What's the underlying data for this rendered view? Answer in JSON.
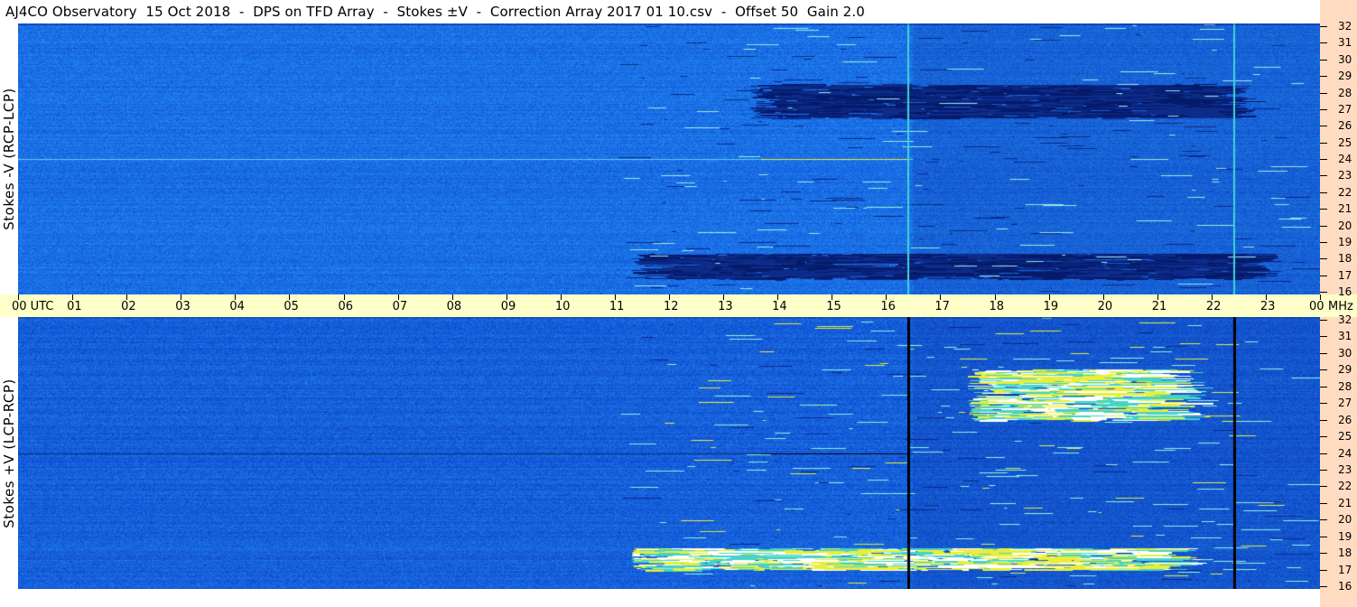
{
  "title": "AJ4CO Observatory  15 Oct 2018  -  DPS on TFD Array  -  Stokes ±V  -  Correction Array 2017 01 10.csv  -  Offset 50  Gain 2.0",
  "panels": [
    {
      "label": "Stokes -V (RCP-LCP)"
    },
    {
      "label": "Stokes +V (LCP-RCP)"
    }
  ],
  "colors": {
    "background_blue": "#1a6be0",
    "deep_blue": "#0b3ea8",
    "time_axis_bg": "#ffffc9",
    "right_strip_bg": "#ffdcc1",
    "spike_cyan": "#3fd6d6",
    "emission_yellow": "#e8ee3a"
  },
  "chart_data": {
    "type": "heatmap",
    "description_of_axes": "time (UTC) vs frequency (MHz)",
    "x": {
      "unit": "UTC",
      "ticks": [
        "00 UTC",
        "01",
        "02",
        "03",
        "04",
        "05",
        "06",
        "07",
        "08",
        "09",
        "10",
        "11",
        "12",
        "13",
        "14",
        "15",
        "16",
        "17",
        "18",
        "19",
        "20",
        "21",
        "22",
        "23",
        "00"
      ],
      "range": [
        0,
        24
      ]
    },
    "y": {
      "unit": "MHz",
      "ticks": [
        "16",
        "17",
        "18",
        "19",
        "20",
        "21",
        "22",
        "23",
        "24",
        "25",
        "26",
        "27",
        "28",
        "29",
        "30",
        "31",
        "32"
      ],
      "range": [
        16,
        32
      ]
    },
    "x_unit_label": "MHz",
    "features": {
      "vertical_lines_utc": [
        16.4,
        22.4
      ],
      "horizontal_lines_mhz": [
        24
      ],
      "emission_bands": [
        {
          "panel": 0,
          "t0": 11.3,
          "t1": 22.5,
          "f0": 16.8,
          "f1": 18.3,
          "tone": "dark"
        },
        {
          "panel": 0,
          "t0": 13.5,
          "t1": 22.0,
          "f0": 26.5,
          "f1": 28.5,
          "tone": "dark"
        },
        {
          "panel": 1,
          "t0": 11.3,
          "t1": 21.0,
          "f0": 17.0,
          "f1": 18.3,
          "tone": "bright"
        },
        {
          "panel": 1,
          "t0": 17.5,
          "t1": 21.0,
          "f0": 26.0,
          "f1": 29.0,
          "tone": "bright"
        }
      ]
    }
  }
}
